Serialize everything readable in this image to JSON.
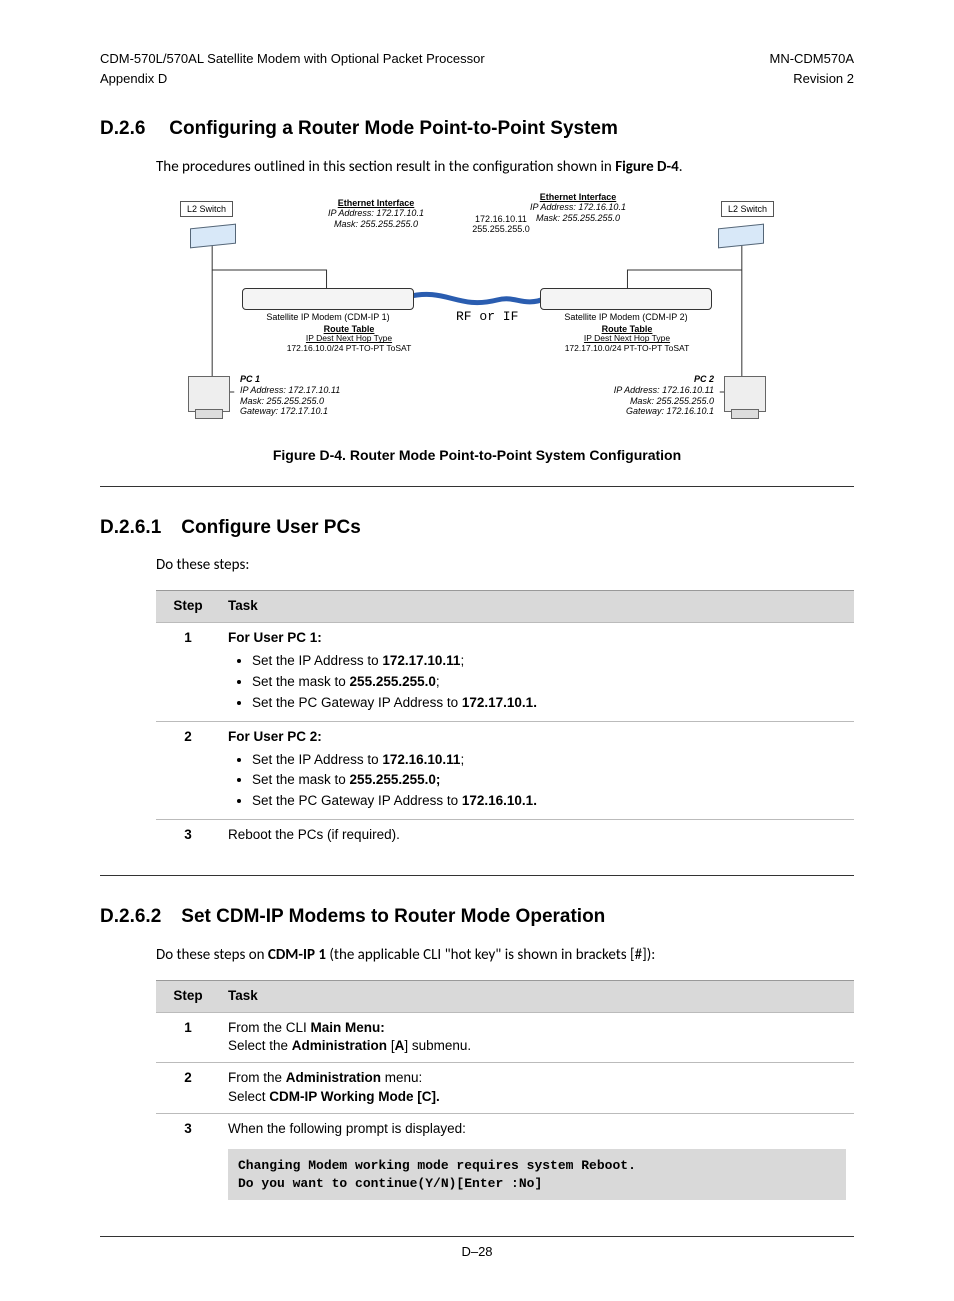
{
  "header": {
    "left1": "CDM-570L/570AL Satellite Modem with Optional Packet Processor",
    "left2": "Appendix D",
    "right1": "MN-CDM570A",
    "right2": "Revision 2"
  },
  "sec_d26": {
    "num": "D.2.6",
    "title": "Configuring a Router Mode Point-to-Point System",
    "intro_a": "The procedures outlined in this section result in the configuration shown in ",
    "intro_b": "Figure D-4",
    "intro_c": "."
  },
  "figure": {
    "caption": "Figure D-4. Router Mode Point-to-Point System Configuration",
    "left_switch": "L2 Switch",
    "right_switch": "L2 Switch",
    "eth_hdr": "Ethernet Interface",
    "eth1_ip": "IP Address:  172.17.10.1",
    "eth1_mask": "Mask:  255.255.255.0",
    "eth2_ip": "IP Address:  172.16.10.1",
    "eth2_mask": "Mask:  255.255.255.0",
    "link_ip": "172.16.10.11",
    "link_mask": "255.255.255.0",
    "rf": "RF or IF",
    "modem1": "Satellite IP Modem (CDM-IP 1)",
    "modem2": "Satellite IP Modem (CDM-IP 2)",
    "rt_hdr": "Route Table",
    "rt_cols": "IP Dest          Next Hop       Type",
    "rt1_row": "172.16.10.0/24   PT-TO-PT     ToSAT",
    "rt2_row": "172.17.10.0/24   PT-TO-PT     ToSAT",
    "pc1_name": "PC 1",
    "pc1_ip": "IP Address: 172.17.10.11",
    "pc1_mask": "Mask: 255.255.255.0",
    "pc1_gw": "Gateway: 172.17.10.1",
    "pc2_name": "PC 2",
    "pc2_ip": "IP Address: 172.16.10.11",
    "pc2_mask": "Mask: 255.255.255.0",
    "pc2_gw": "Gateway: 172.16.10.1"
  },
  "sec_d261": {
    "num": "D.2.6.1",
    "title": "Configure User PCs",
    "intro": "Do these steps:",
    "col_step": "Step",
    "col_task": "Task",
    "r1": {
      "lead": "For User PC 1:",
      "b1a": "Set the IP Address to ",
      "b1b": "172.17.10.11",
      "b1c": ";",
      "b2a": "Set the mask to ",
      "b2b": "255.255.255.0",
      "b2c": ";",
      "b3a": "Set the PC Gateway IP Address to ",
      "b3b": "172.17.10.1."
    },
    "r2": {
      "lead": "For User PC 2:",
      "b1a": "Set the IP Address to ",
      "b1b": "172.16.10.11",
      "b1c": ";",
      "b2a": "Set the mask to ",
      "b2b": "255.255.255.0;",
      "b3a": "Set the PC Gateway IP Address to ",
      "b3b": "172.16.10.1."
    },
    "r3": "Reboot the PCs (if required)."
  },
  "sec_d262": {
    "num": "D.2.6.2",
    "title": "Set CDM-IP Modems to Router Mode Operation",
    "intro_a": "Do these steps on ",
    "intro_b": "CDM-IP 1",
    "intro_c": " (the applicable CLI \"hot key\" is shown in brackets [#]):",
    "col_step": "Step",
    "col_task": "Task",
    "r1_a": "From the CLI ",
    "r1_b": "Main Menu:",
    "r1_c": "Select the ",
    "r1_d": "Administration",
    "r1_e": " [",
    "r1_f": "A",
    "r1_g": "] submenu.",
    "r2_a": "From the ",
    "r2_b": "Administration",
    "r2_c": " menu:",
    "r2_d": "Select ",
    "r2_e": "CDM-IP Working Mode [C].",
    "r3_a": "When the following prompt is displayed:",
    "r3_code": "Changing Modem working mode requires system Reboot.\nDo you want to continue(Y/N)[Enter :No]"
  },
  "footer": "D–28"
}
